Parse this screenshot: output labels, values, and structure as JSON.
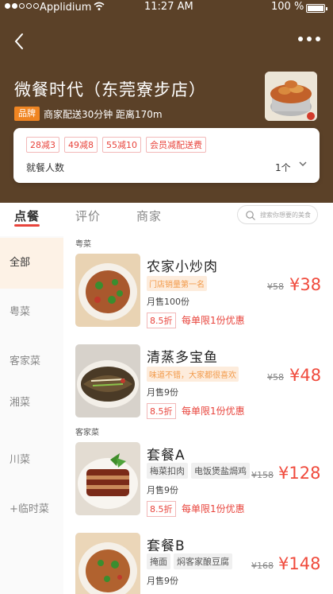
{
  "status_bar": {
    "carrier": "Applidium",
    "time": "11:27 AM",
    "battery": "100 %"
  },
  "shop": {
    "name": "微餐时代（东莞寮步店）",
    "badge": "品牌",
    "delivery": "商家配送30分钟",
    "distance": "距离170m"
  },
  "promos": [
    "28减3",
    "49减8",
    "55减10",
    "会员减配送费"
  ],
  "diners": {
    "label": "就餐人数",
    "value": "1个"
  },
  "tabs": [
    {
      "label": "点餐"
    },
    {
      "label": "评价"
    },
    {
      "label": "商家"
    }
  ],
  "search": {
    "placeholder": "搜索你想要的美食"
  },
  "sidebar": [
    {
      "label": "全部"
    },
    {
      "label": "粤菜"
    },
    {
      "label": "客家菜"
    },
    {
      "label": "湘菜"
    },
    {
      "label": "川菜"
    },
    {
      "label": "+临时菜"
    }
  ],
  "sections": {
    "cantonese": "粤菜",
    "hakka": "客家菜"
  },
  "dishes": [
    {
      "name": "农家小炒肉",
      "tag": "门店销量第一名",
      "sold": "月售100份",
      "discount": "8.5折",
      "limit": "每单限1份优惠",
      "old_price": "¥58",
      "price": "¥38"
    },
    {
      "name": "清蒸多宝鱼",
      "tag": "味道不错，大家都很喜欢",
      "sold": "月售9份",
      "discount": "8.5折",
      "limit": "每单限1份优惠",
      "old_price": "¥58",
      "price": "¥48"
    },
    {
      "name": "套餐A",
      "tags": [
        "梅菜扣肉",
        "电饭煲盐焗鸡"
      ],
      "sold": "月售9份",
      "discount": "8.5折",
      "limit": "每单限1份优惠",
      "old_price": "¥158",
      "price": "¥128"
    },
    {
      "name": "套餐B",
      "tags": [
        "掩面",
        "焖客家酿豆腐"
      ],
      "sold": "月售9份",
      "old_price": "¥168",
      "price": "¥148"
    }
  ],
  "colors": {
    "header": "#5b4128",
    "accent": "#e8443c",
    "brand_badge": "#f08522",
    "price": "#f04a3c"
  }
}
